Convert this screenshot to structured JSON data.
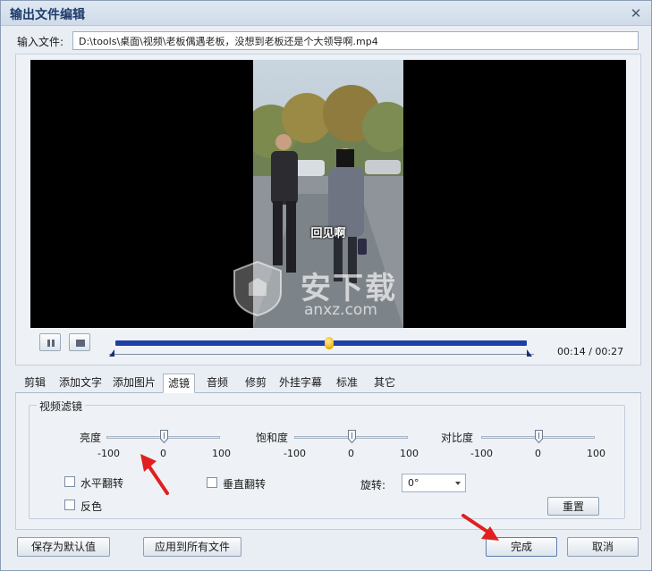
{
  "window": {
    "title": "输出文件编辑",
    "close_glyph": "✕"
  },
  "input": {
    "label": "输入文件:",
    "value": "D:\\tools\\桌面\\视频\\老板偶遇老板，没想到老板还是个大领导啊.mp4"
  },
  "video": {
    "caption": "回见啊",
    "watermark_text": "安下载",
    "watermark_sub": "anxz.com"
  },
  "player": {
    "pause_icon": "pause-icon",
    "stop_icon": "stop-icon",
    "time": "00:14 / 00:27",
    "progress": 0.52
  },
  "tabs": [
    {
      "label": "剪辑",
      "active": false
    },
    {
      "label": "添加文字",
      "active": false
    },
    {
      "label": "添加图片",
      "active": false
    },
    {
      "label": "滤镜",
      "active": true
    },
    {
      "label": "音频",
      "active": false
    },
    {
      "label": "修剪",
      "active": false
    },
    {
      "label": "外挂字幕",
      "active": false
    },
    {
      "label": "标准",
      "active": false
    },
    {
      "label": "其它",
      "active": false
    }
  ],
  "filters": {
    "group_title": "视频滤镜",
    "brightness": {
      "label": "亮度",
      "min": "-100",
      "mid": "0",
      "max": "100",
      "value": 0
    },
    "saturation": {
      "label": "饱和度",
      "min": "-100",
      "mid": "0",
      "max": "100",
      "value": 0
    },
    "contrast": {
      "label": "对比度",
      "min": "-100",
      "mid": "0",
      "max": "100",
      "value": 0
    },
    "hflip": {
      "label": "水平翻转",
      "checked": false
    },
    "vflip": {
      "label": "垂直翻转",
      "checked": false
    },
    "invert": {
      "label": "反色",
      "checked": false
    },
    "rotate": {
      "label": "旋转:",
      "value": "0°"
    },
    "reset_label": "重置"
  },
  "footer": {
    "save_default": "保存为默认值",
    "apply_all": "应用到所有文件",
    "done": "完成",
    "cancel": "取消"
  },
  "colors": {
    "accent_track": "#1f3fa8",
    "annotation_arrow": "#e02020"
  }
}
